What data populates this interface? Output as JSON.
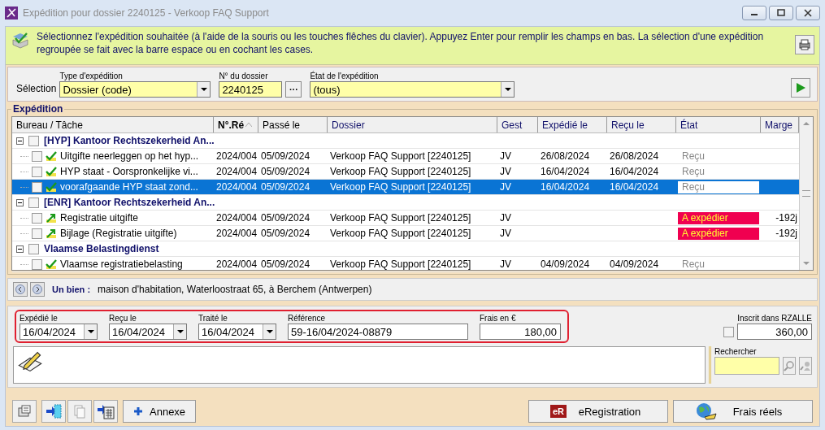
{
  "window": {
    "title": "Expédition pour dossier 2240125 - Verkoop FAQ Support"
  },
  "info": {
    "text": "Sélectionnez l'expédition souhaitée (à l'aide de la souris ou les touches flêches du clavier). Appuyez Enter pour remplir les champs en bas. La sélection d'une expédition regroupée se fait avec la barre espace ou en cochant les cases."
  },
  "selection": {
    "label": "Sélection",
    "type": {
      "label": "Type d'expédition",
      "value": "Dossier (code)"
    },
    "dossier": {
      "label": "N° du dossier",
      "value": "2240125",
      "button": "···"
    },
    "etat": {
      "label": "État de l'expédition",
      "value": "(tous)"
    }
  },
  "expedition": {
    "title": "Expédition",
    "columns": [
      {
        "label": "Bureau / Tâche",
        "sorted": false
      },
      {
        "label": "N°.Ré",
        "sorted": true
      },
      {
        "label": "Passé le",
        "sorted": false
      },
      {
        "label": "Dossier",
        "sorted": false
      },
      {
        "label": "Gest",
        "sorted": false
      },
      {
        "label": "Expédié le",
        "sorted": false
      },
      {
        "label": "Reçu le",
        "sorted": false
      },
      {
        "label": "État",
        "sorted": false
      },
      {
        "label": "Marge",
        "sorted": false
      }
    ],
    "rows": [
      {
        "kind": "group",
        "label": "[HYP] Kantoor Rechtszekerheid An...",
        "expanded": true,
        "checked": false
      },
      {
        "kind": "received",
        "checked": false,
        "selected": false,
        "cells": [
          "Uitgifte neerleggen op het hyp...",
          "2024/004",
          "05/09/2024",
          "Verkoop FAQ Support [2240125]",
          "JV",
          "26/08/2024",
          "26/08/2024"
        ],
        "etat": "Reçu"
      },
      {
        "kind": "received",
        "checked": false,
        "selected": false,
        "cells": [
          "HYP staat - Oorspronkelijke vi...",
          "2024/004",
          "05/09/2024",
          "Verkoop FAQ Support [2240125]",
          "JV",
          "16/04/2024",
          "16/04/2024"
        ],
        "etat": "Reçu"
      },
      {
        "kind": "received",
        "checked": false,
        "selected": true,
        "cells": [
          "voorafgaande HYP staat zond...",
          "2024/004",
          "05/09/2024",
          "Verkoop FAQ Support [2240125]",
          "JV",
          "16/04/2024",
          "16/04/2024"
        ],
        "etat": "Reçu"
      },
      {
        "kind": "group",
        "label": "[ENR] Kantoor Rechtszekerheid An...",
        "expanded": true,
        "checked": false
      },
      {
        "kind": "to_send",
        "checked": false,
        "selected": false,
        "cells": [
          "Registratie uitgifte",
          "2024/004",
          "05/09/2024",
          "Verkoop FAQ Support [2240125]",
          "JV"
        ],
        "etat": "A expédier",
        "marge": "-192j"
      },
      {
        "kind": "to_send",
        "checked": false,
        "selected": false,
        "cells": [
          "Bijlage (Registratie uitgifte)",
          "2024/004",
          "05/09/2024",
          "Verkoop FAQ Support [2240125]",
          "JV"
        ],
        "etat": "A expédier",
        "marge": "-192j"
      },
      {
        "kind": "group",
        "label": "Vlaamse Belastingdienst",
        "expanded": true,
        "checked": false
      },
      {
        "kind": "received",
        "checked": false,
        "selected": false,
        "cells": [
          "Vlaamse registratiebelasting",
          "2024/004",
          "05/09/2024",
          "Verkoop FAQ Support [2240125]",
          "JV",
          "04/09/2024",
          "04/09/2024"
        ],
        "etat": "Reçu"
      }
    ]
  },
  "bien": {
    "label": "Un bien :",
    "value": "maison d'habitation, Waterloostraat 65, à Berchem (Antwerpen)"
  },
  "details": {
    "expedie": {
      "label": "Expédié le",
      "value": "16/04/2024"
    },
    "recu": {
      "label": "Reçu le",
      "value": "16/04/2024"
    },
    "traite": {
      "label": "Traité le",
      "value": "16/04/2024"
    },
    "reference": {
      "label": "Référence",
      "value": "59-16/04/2024-08879"
    },
    "frais": {
      "label": "Frais en €",
      "value": "180,00"
    },
    "inscrit": {
      "label": "Inscrit dans RZALLE",
      "checked": false,
      "value": "360,00"
    },
    "rechercher": {
      "label": "Rechercher"
    }
  },
  "buttons": {
    "annexe": "Annexe",
    "eregistration": {
      "badge": "eR",
      "label": "eRegistration"
    },
    "frais_reels": "Frais réels"
  }
}
